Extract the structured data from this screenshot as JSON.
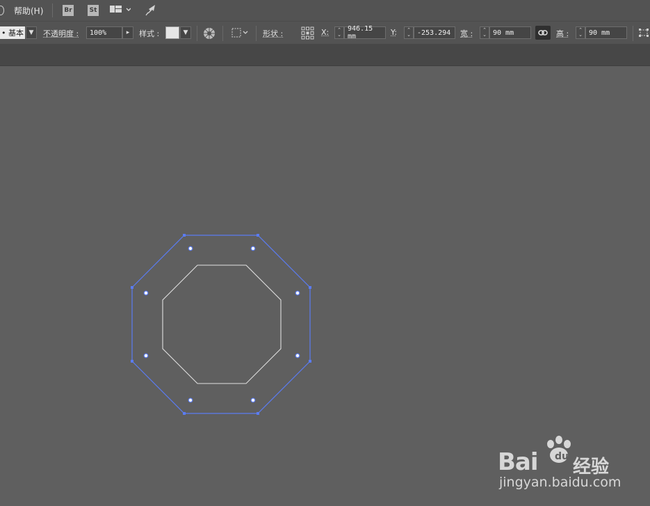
{
  "menubar": {
    "help_label": "帮助(H)",
    "bridge_label": "Br",
    "stock_label": "St",
    "workspace_icon": "workspace-layout-icon",
    "publish_icon": "rocket-icon"
  },
  "controlbar": {
    "stroke_style_value": "• 基本",
    "opacity_label": "不透明度 :",
    "opacity_value": "100%",
    "style_label": "样式 :",
    "shape_label": "形状 :",
    "x_label": "X:",
    "x_value": "946.15 mm",
    "y_label": "Y:",
    "y_value": "-253.294",
    "width_label": "宽 :",
    "width_value": "90 mm",
    "height_label": "高 :",
    "height_value": "90 mm"
  },
  "canvas": {
    "selection_color": "#5b7cf2",
    "outline_color": "#e0e0e0",
    "shapes": [
      "outer-octagon-selected",
      "inner-octagon"
    ]
  },
  "watermark": {
    "brand": "Bai",
    "brand_cn": "经验",
    "url": "jingyan.baidu.com"
  }
}
